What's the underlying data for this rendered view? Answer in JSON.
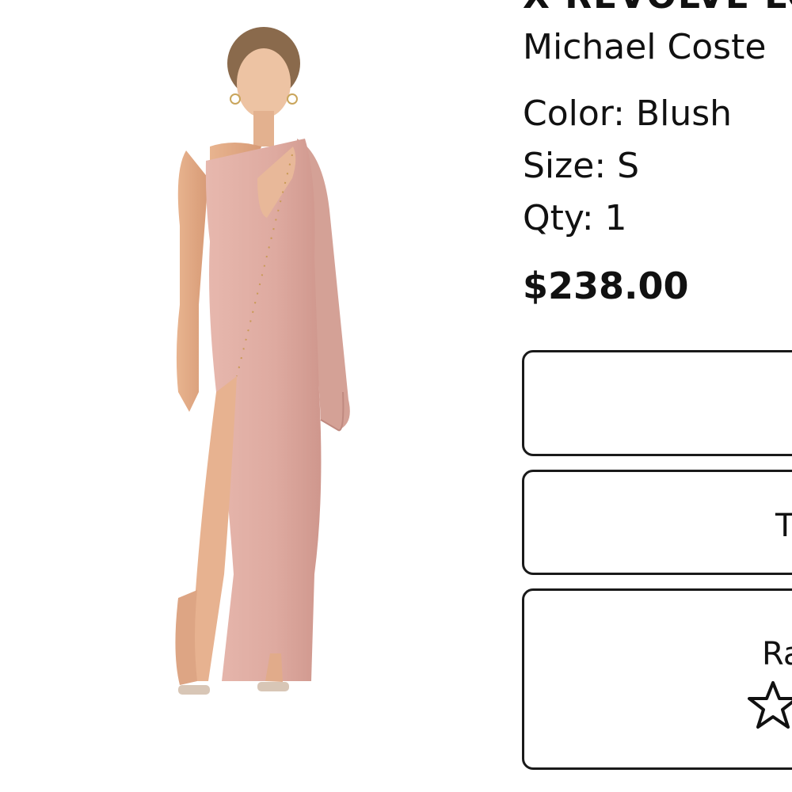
{
  "product": {
    "title": "X REVOLVE LO",
    "designer": "Michael Coste",
    "color_label": "Color: Blush",
    "size_label": "Size: S",
    "qty_label": "Qty: 1",
    "price": "$238.00",
    "image_alt": "Blush one-shoulder maxi dress with cape sleeve and thigh slit"
  },
  "cards": [
    {
      "label": ""
    },
    {
      "label": "T"
    },
    {
      "label": "Ra",
      "icon": "star-outline-icon"
    }
  ],
  "colors": {
    "dress": "#e0aea5",
    "card_border": "#1a1a1a",
    "text": "#111111"
  }
}
